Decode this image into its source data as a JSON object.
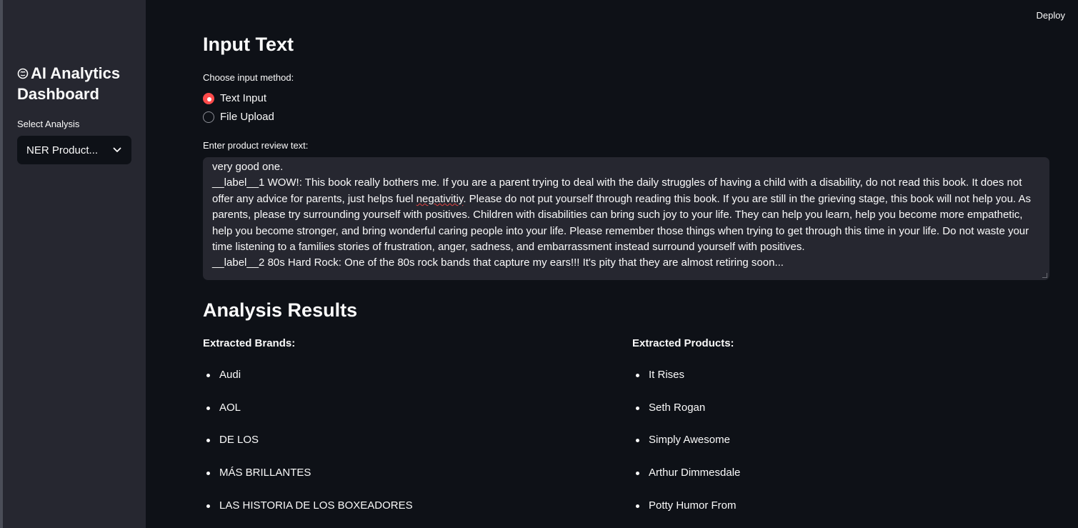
{
  "header": {
    "deploy_label": "Deploy"
  },
  "sidebar": {
    "title": "AI Analytics Dashboard",
    "select_label": "Select Analysis",
    "select_value": "NER Product..."
  },
  "input_section": {
    "heading": "Input Text",
    "method_label": "Choose input method:",
    "options": [
      {
        "label": "Text Input",
        "selected": true
      },
      {
        "label": "File Upload",
        "selected": false
      }
    ],
    "textarea_label": "Enter product review text:",
    "textarea_lines": {
      "l1": "very good one.",
      "l2a": "__label__1 WOW!: This book really bothers me. If you are a parent trying to deal with the daily struggles of having a child with a disability, do not read this book. It does not offer any advice for parents, just helps fuel ",
      "l2_misspelled": "negativitiy",
      "l2b": ". Please do not put yourself through reading this book. If you are still in the grieving stage, this book will not help you. As parents, please try surrounding yourself with positives. Children with disabilities can bring such joy to your life. They can help you learn, help you become more empathetic, help you become stronger, and bring wonderful caring people into your life. Please remember those things when trying to get through this time in your life. Do not waste your time listening to a families stories of frustration, anger, sadness, and embarrassment instead surround yourself with positives.",
      "l3": "__label__2 80s Hard Rock: One of the 80s rock bands that capture my ears!!! It's pity that they are almost retiring soon..."
    }
  },
  "results": {
    "heading": "Analysis Results",
    "brands_label": "Extracted Brands:",
    "brands": [
      "Audi",
      "AOL",
      "DE LOS",
      "MÁS BRILLANTES",
      "LAS HISTORIA DE LOS BOXEADORES"
    ],
    "products_label": "Extracted Products:",
    "products": [
      "It Rises",
      "Seth Rogan",
      "Simply Awesome",
      "Arthur Dimmesdale",
      "Potty Humor From"
    ]
  }
}
